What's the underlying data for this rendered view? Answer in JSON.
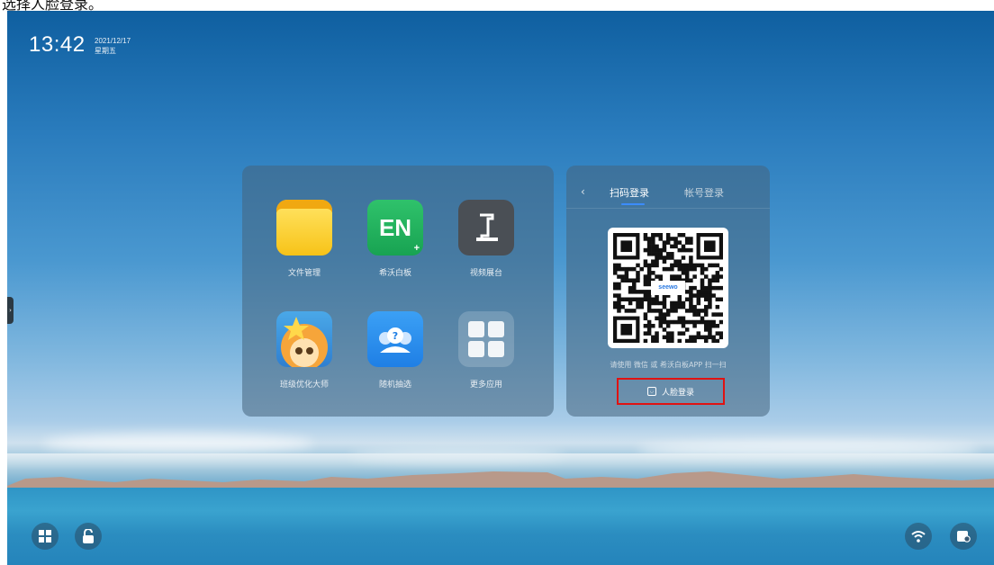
{
  "caption": "选择人脸登录。",
  "clock": {
    "time": "13:42",
    "date": "2021/12/17",
    "weekday": "星期五"
  },
  "apps": [
    {
      "label": "文件管理",
      "icon": "folder-icon"
    },
    {
      "label": "希沃白板",
      "icon": "seewo-whiteboard-icon",
      "badge": "EN"
    },
    {
      "label": "视频展台",
      "icon": "document-camera-icon"
    },
    {
      "label": "班级优化大师",
      "icon": "class-optimizer-icon"
    },
    {
      "label": "随机抽选",
      "icon": "random-pick-icon"
    },
    {
      "label": "更多应用",
      "icon": "grid-icon"
    }
  ],
  "login": {
    "back": "‹",
    "tab_qr": "扫码登录",
    "tab_account": "帐号登录",
    "qr_brand": "seewo",
    "hint": "请使用 微信 或 希沃白板APP 扫一扫",
    "face_login": "人脸登录"
  },
  "colors": {
    "accent": "#3b8cff",
    "highlight": "#e01212"
  }
}
